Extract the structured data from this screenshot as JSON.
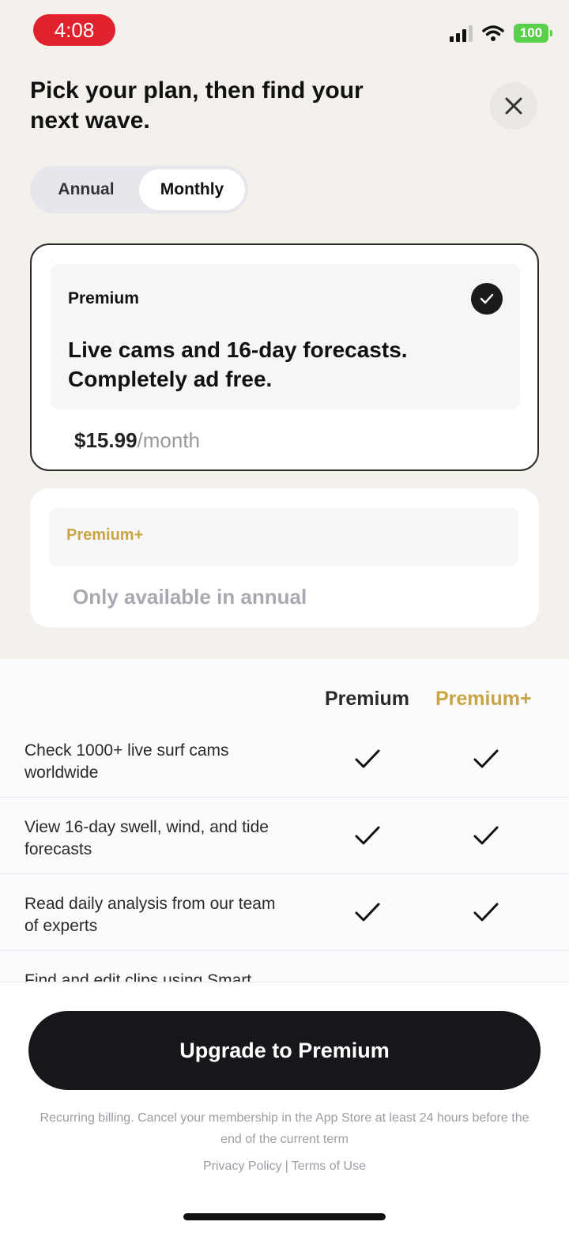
{
  "status_bar": {
    "time": "4:08",
    "battery": "100"
  },
  "header": {
    "title": "Pick your plan, then find your next wave."
  },
  "billing_toggle": {
    "annual_label": "Annual",
    "monthly_label": "Monthly",
    "selected": "Monthly"
  },
  "plans": {
    "premium": {
      "name": "Premium",
      "description": "Live cams and 16-day forecasts. Completely ad free.",
      "price": "$15.99",
      "period": "/month",
      "selected": true
    },
    "premium_plus": {
      "name": "Premium+",
      "note": "Only available in annual"
    }
  },
  "comparison": {
    "columns": [
      "Premium",
      "Premium+"
    ],
    "rows": [
      {
        "feature": "Check 1000+ live surf cams worldwide",
        "premium": true,
        "premium_plus": true
      },
      {
        "feature": "View 16-day swell, wind, and tide forecasts",
        "premium": true,
        "premium_plus": true
      },
      {
        "feature": "Read daily analysis from our team of experts",
        "premium": true,
        "premium_plus": true
      },
      {
        "feature": "Find and edit clips using Smart",
        "premium": null,
        "premium_plus": null
      }
    ]
  },
  "cta": {
    "label": "Upgrade to Premium"
  },
  "legal": {
    "text": "Recurring billing. Cancel your membership in the App Store at least 24 hours before the end of the current term",
    "privacy": "Privacy Policy",
    "separator": "|",
    "terms": "Terms of Use"
  },
  "colors": {
    "accent_gold": "#c9a445",
    "dark": "#17161a",
    "status_red": "#e0222f"
  }
}
